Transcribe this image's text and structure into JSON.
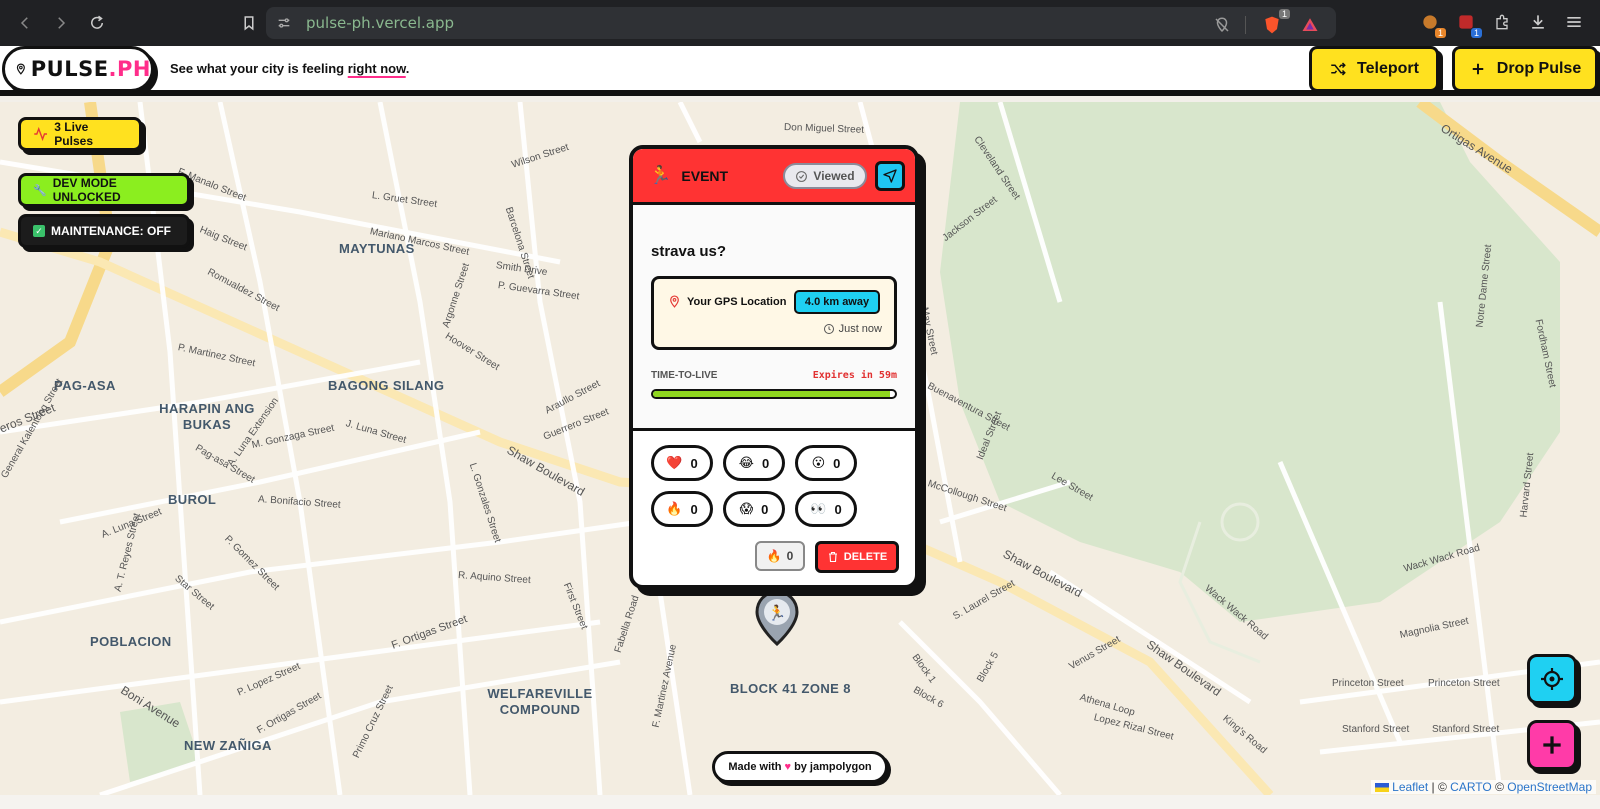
{
  "browser": {
    "url": "pulse-ph.vercel.app",
    "ext_badge_1": "1",
    "ext_badge_2": "1"
  },
  "header": {
    "logo_main": "PULSE",
    "logo_suffix": ".PH",
    "tagline_pre": "See what your city is feeling ",
    "tagline_highlight": "right now",
    "tagline_post": ".",
    "teleport_label": "Teleport",
    "drop_label": "Drop Pulse"
  },
  "badges": {
    "live": "3 Live Pulses",
    "dev": "DEV MODE UNLOCKED",
    "maintenance": "MAINTENANCE: OFF"
  },
  "card": {
    "category": "EVENT",
    "viewed_label": "Viewed",
    "text": "strava us?",
    "location_label": "Your GPS Location",
    "distance": "4.0 km away",
    "time": "Just now",
    "ttl_label": "TIME-TO-LIVE",
    "expires": "Expires in 59m",
    "ttl_remaining_fraction": 0.98,
    "reactions": [
      {
        "icon": "heart-icon",
        "glyph": "❤️",
        "count": "0"
      },
      {
        "icon": "laugh-icon",
        "glyph": "😂",
        "count": "0"
      },
      {
        "icon": "wow-icon",
        "glyph": "😮",
        "count": "0"
      },
      {
        "icon": "fire-icon",
        "glyph": "🔥",
        "count": "0"
      },
      {
        "icon": "scream-icon",
        "glyph": "😱",
        "count": "0"
      },
      {
        "icon": "eyes-icon",
        "glyph": "👀",
        "count": "0"
      }
    ],
    "fire_count": "0",
    "delete_label": "DELETE"
  },
  "map": {
    "areas": [
      {
        "id": "maytunas",
        "label": "MAYTUNAS"
      },
      {
        "id": "bagong-silang",
        "label": "BAGONG SILANG"
      },
      {
        "id": "pag-asa",
        "label": "PAG-ASA"
      },
      {
        "id": "harapin",
        "label": "HARAPIN ANG BUKAS"
      },
      {
        "id": "burol",
        "label": "BUROL"
      },
      {
        "id": "poblacion",
        "label": "POBLACION"
      },
      {
        "id": "welfareville",
        "label": "WELFAREVILLE COMPOUND"
      },
      {
        "id": "block41",
        "label": "BLOCK 41 ZONE 8"
      },
      {
        "id": "new-zaniga",
        "label": "NEW ZAÑIGA"
      }
    ],
    "streets": {
      "wilson": "Wilson Street",
      "f_manalo": "F. Manalo Street",
      "haig": "Haig Street",
      "l_gruet": "L. Gruet Street",
      "mariano": "Mariano Marcos Street",
      "smith": "Smith Drive",
      "p_guevarra": "P. Guevarra Street",
      "hoover": "Hoover Street",
      "shaw1": "Shaw Boulevard",
      "shaw2": "Shaw Boulevard",
      "shaw3": "Shaw Boulevard",
      "ortigas_ave": "Ortigas Avenue",
      "f_ortigas": "F. Ortigas Street",
      "f_ortigas2": "F. Ortigas Street",
      "boni": "Boni Avenue",
      "don_miguel": "Don Miguel Street",
      "lee": "Lee Street",
      "wack": "Wack Wack Road",
      "wack2": "Wack Wack Road",
      "magnolia": "Magnolia Street",
      "princeton": "Princeton Street",
      "princeton2": "Princeton Street",
      "stanford": "Stanford Street",
      "stanford2": "Stanford Street",
      "s_laurel": "S. Laurel Street",
      "mccollough": "McCollough Street",
      "ideal": "Ideal Street",
      "buenaventura": "Buenaventura Street",
      "venus": "Venus Street",
      "athena": "Athena Loop",
      "lopez_rizal": "Lopez Rizal Street",
      "kings": "King's Road",
      "fabella": "Fabella Road",
      "f_martinez": "F. Martinez Avenue",
      "primo_cruz": "Primo Cruz Street",
      "first": "First Street",
      "r_aquino": "R. Aquino Street",
      "a_bonifacio": "A. Bonifacio Street",
      "a_luna": "A. Luna Street",
      "j_luna": "J. Luna Street",
      "m_gonzaga": "M. Gonzaga Street",
      "p_martinez": "P. Martinez Street",
      "a_luna_ext": "A. Luna Extension",
      "romualdez": "Romualdez Street",
      "araullo": "Araullo Street",
      "guerrero": "Guerrero Street",
      "l_gonzales": "L. Gonzales Street",
      "barcelona": "Barcelona Street",
      "argonne": "Argonne Street",
      "jackson": "Jackson Street",
      "cleveland": "Cleveland Street",
      "may": "May Street",
      "notre_dame": "Notre Dame Street",
      "fordham": "Fordham Street",
      "harvard": "Harvard Street",
      "block1": "Block 1",
      "block5": "Block 5",
      "block6": "Block 6",
      "at_reyes": "A. T. Reyes Street",
      "p_gomez": "P. Gomez Street",
      "star": "Star Street",
      "p_lopez": "P. Lopez Street",
      "eros": "eros Street",
      "kalentong": "General Kalentong Street",
      "pag_asa_ave": "Pag-asa Street"
    }
  },
  "footer": {
    "made_with_pre": "Made with",
    "made_with_post": "by",
    "author": "jampolygon",
    "leaflet": "Leaflet",
    "sep1": "| ©",
    "carto": "CARTO",
    "sep2": "©",
    "osm": "OpenStreetMap"
  }
}
